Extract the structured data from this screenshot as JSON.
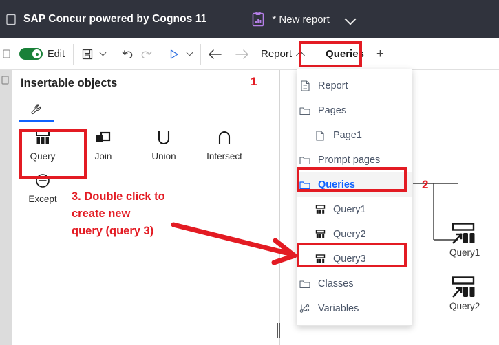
{
  "titlebar": {
    "brand": "SAP Concur powered by Cognos 11",
    "report_icon": "clipboard-chart-icon",
    "report_name": "* New report",
    "chevron": "chevron-down-icon"
  },
  "toolbar": {
    "edit_toggle_label": "Edit",
    "edit_toggle_on": true,
    "save_icon": "save-icon",
    "save_caret_icon": "chevron-down-icon",
    "undo_icon": "undo-icon",
    "redo_icon": "redo-icon",
    "run_icon": "run-play-icon",
    "run_caret_icon": "chevron-down-icon",
    "back_icon": "arrow-left-icon",
    "forward_icon": "arrow-right-icon",
    "tabs": [
      {
        "label": "Report",
        "caret": "chevron-up-icon",
        "active": true,
        "highlighted": true
      },
      {
        "label": "Queries",
        "active": false,
        "highlighted": false
      }
    ],
    "add_tab_label": "+"
  },
  "panel": {
    "title": "Insertable objects",
    "tab_icon": "wrench-icon",
    "objects": [
      {
        "label": "Query",
        "icon": "query-icon",
        "highlighted": true
      },
      {
        "label": "Join",
        "icon": "join-icon",
        "highlighted": false
      },
      {
        "label": "Union",
        "icon": "union-icon",
        "highlighted": false
      },
      {
        "label": "Intersect",
        "icon": "intersect-icon",
        "highlighted": false
      },
      {
        "label": "Except",
        "icon": "except-icon",
        "highlighted": false
      }
    ]
  },
  "menu": {
    "items": [
      {
        "label": "Report",
        "icon": "document-icon",
        "indent": 0,
        "selected": false
      },
      {
        "label": "Pages",
        "icon": "folder-icon",
        "indent": 0,
        "selected": false
      },
      {
        "label": "Page1",
        "icon": "page-icon",
        "indent": 1,
        "selected": false
      },
      {
        "label": "Prompt pages",
        "icon": "folder-icon",
        "indent": 0,
        "selected": false
      },
      {
        "label": "Queries",
        "icon": "folder-icon",
        "indent": 0,
        "selected": true
      },
      {
        "label": "Query1",
        "icon": "query-icon",
        "indent": 1,
        "selected": false
      },
      {
        "label": "Query2",
        "icon": "query-icon",
        "indent": 1,
        "selected": false
      },
      {
        "label": "Query3",
        "icon": "query-icon",
        "indent": 1,
        "selected": false
      },
      {
        "label": "Classes",
        "icon": "folder-icon",
        "indent": 0,
        "selected": false
      },
      {
        "label": "Variables",
        "icon": "variables-icon",
        "indent": 0,
        "selected": false
      }
    ]
  },
  "canvas": {
    "nodes": [
      {
        "label": "Query1",
        "icon": "query-node-icon"
      },
      {
        "label": "Query2",
        "icon": "query-node-icon"
      }
    ]
  },
  "annotations": {
    "step1": "1",
    "step2": "2",
    "step3": "3. Double click to\ncreate new\nquery (query 3)",
    "arrow": "red-arrow"
  },
  "colors": {
    "titlebar_bg": "#30333d",
    "accent_blue": "#0f62fe",
    "toggle_green": "#198038",
    "annotation_red": "#e31b23",
    "menu_text": "#4a5568"
  }
}
